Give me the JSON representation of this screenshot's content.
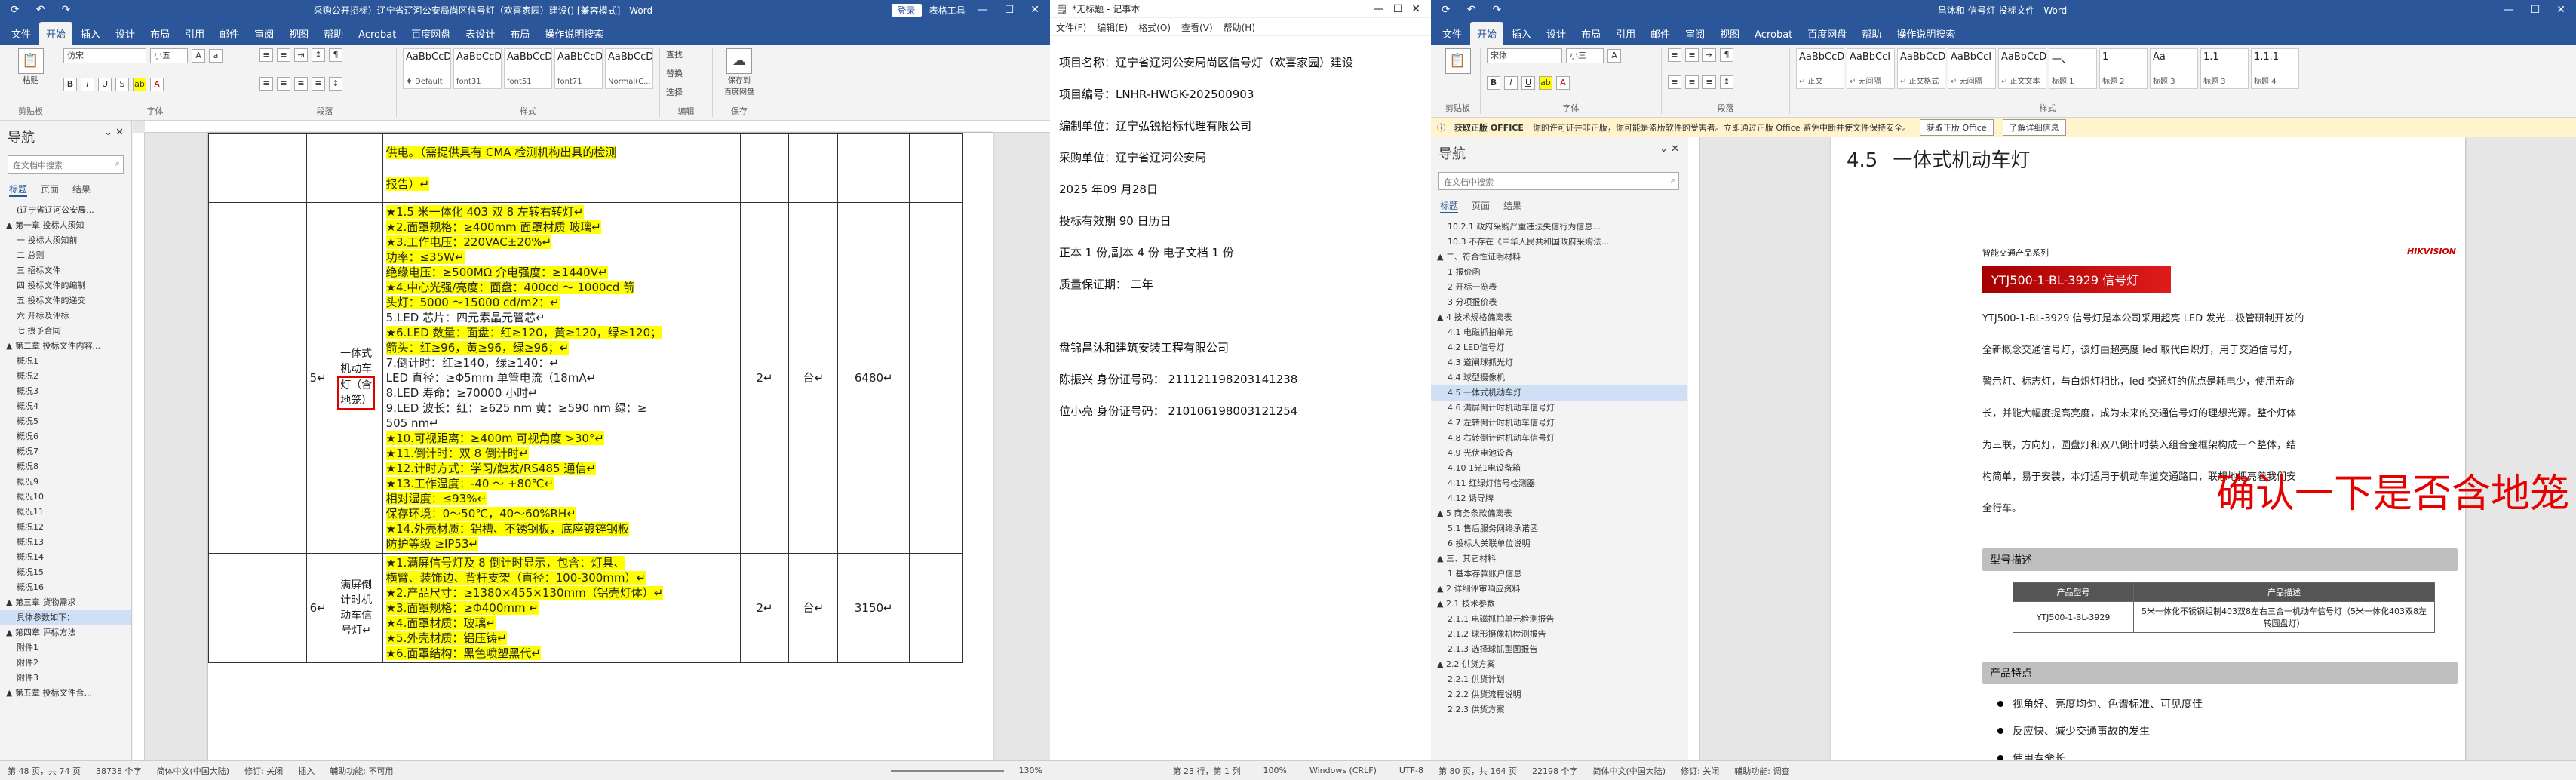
{
  "w1": {
    "title": "采购公开招标）辽宁省辽河公安局尚区信号灯（欢喜家园）建设() [兼容模式] - Word",
    "title_sign": "登录",
    "title_tool": "表格工具",
    "menu": [
      "文件",
      "开始",
      "插入",
      "设计",
      "布局",
      "引用",
      "邮件",
      "审阅",
      "视图",
      "帮助",
      "Acrobat",
      "百度网盘",
      "表设计",
      "布局"
    ],
    "menu_tell": "操作说明搜索",
    "ribbon": {
      "paste": "粘贴",
      "font_name": "仿宋",
      "font_size": "小五",
      "groups": [
        "剪贴板",
        "字体",
        "段落",
        "样式",
        "编辑",
        "保存",
        "加载项"
      ],
      "styles": [
        {
          "prev": "AaBbCcDd",
          "nm": "♦ Default"
        },
        {
          "prev": "AaBbCcDd",
          "nm": "font31"
        },
        {
          "prev": "AaBbCcDd",
          "nm": "font51"
        },
        {
          "prev": "AaBbCcDd",
          "nm": "font71"
        },
        {
          "prev": "AaBbCcDc",
          "nm": "Normal(C..."
        }
      ],
      "edit": [
        "查找",
        "替换",
        "选择"
      ],
      "save": "保存到\n百度网盘"
    },
    "nav": {
      "title": "导航",
      "search": "在文档中搜索",
      "tabs": [
        "标题",
        "页面",
        "结果"
      ],
      "items": [
        "(辽宁省辽河公安局...",
        "▲ 第一章 投标人须知",
        "一 投标人须知前",
        "二 总则",
        "三 招标文件",
        "四 投标文件的编制",
        "五 投标文件的递交",
        "六 开标及评标",
        "七 授予合同",
        "▲ 第二章 投标文件内容...",
        "概况1",
        "概况2",
        "概况3",
        "概况4",
        "概况5",
        "概况6",
        "概况7",
        "概况8",
        "概况9",
        "概况10",
        "概况11",
        "概况12",
        "概况13",
        "概况14",
        "概况15",
        "概况16",
        "▲ 第三章 货物需求",
        "具体参数如下：",
        "▲ 第四章 评标方法",
        "附件1",
        "附件2",
        "附件3",
        "▲ 第五章 投标文件合..."
      ],
      "selected_index": 27
    },
    "table": {
      "row_top": {
        "spec_lines": [
          "供电。（需提供具有 CMA 检测机构出具的检测",
          "报告）↵"
        ]
      },
      "row5": {
        "no": "5↵",
        "name_lines": [
          "一体式",
          "机动车",
          "灯（含",
          "地笼）"
        ],
        "spec_lines": [
          "★1.5 米一体化 403 双 8 左转右转灯↵",
          "★2.面罩规格：≥400mm 面罩材质 玻璃↵",
          "★3.工作电压：220VAC±20%↵",
          "功率：≤35W↵",
          "绝缘电压：≥500MΩ  介电强度：≥1440V↵",
          "★4.中心光强/亮度：面盘：400cd ～ 1000cd  箭",
          "头灯：5000 ～15000 cd/m2：↵",
          "5.LED 芯片：四元素晶元管芯↵",
          "★6.LED 数量：面盘：红≥120，黄≥120，绿≥120；",
          "箭头：红≥96，黄≥96，绿≥96；↵",
          "7.倒计时：红≥140，绿≥140：↵",
          "LED 直径：≥Φ5mm 单管电流（18mA↵",
          "8.LED 寿命：≥70000 小时↵",
          "9.LED 波长：红：≥625 nm 黄：≥590 nm 绿：≥",
          "505 nm↵",
          "★10.可视距离：≥400m 可视角度 >30°↵",
          "★11.倒计时：双 8 倒计时↵",
          "★12.计时方式：学习/触发/RS485 通信↵",
          "★13.工作温度：-40 ～ +80℃↵",
          "相对湿度：≤93%↵",
          "保存环境：0～50℃，40～60%RH↵",
          "★14.外壳材质：铝槽、不锈钢板，底座镀锌钢板",
          "防护等级 ≥IP53↵"
        ],
        "qty": "2↵",
        "unit": "台↵",
        "price": "6480↵"
      },
      "row6": {
        "no": "6↵",
        "name_lines": [
          "满屏倒",
          "计时机",
          "动车信",
          "号灯↵"
        ],
        "spec_lines": [
          "★1.满屏信号灯及 8 倒计时显示，包含：灯具、",
          "横臂、装饰边、背杆支架（直径：100-300mm）↵",
          "★2.产品尺寸：≥1380×455×130mm（铝壳灯体）↵",
          "★3.面罩规格：≥Φ400mm ↵",
          "★4.面罩材质：玻璃↵",
          "★5.外壳材质：铝压铸↵",
          "★6.面罩结构：黑色喷塑黑代↵"
        ],
        "qty": "2↵",
        "unit": "台↵",
        "price": "3150↵"
      }
    },
    "status": [
      "第 48 页，共 74 页",
      "38738 个字",
      "简体中文(中国大陆)",
      "修订: 关闭",
      "插入",
      "辅助功能: 不可用"
    ],
    "zoom": "130%"
  },
  "w2": {
    "title": "*无标题 - 记事本",
    "menu": [
      "文件(F)",
      "编辑(E)",
      "格式(O)",
      "查看(V)",
      "帮助(H)"
    ],
    "lines": [
      "项目名称：辽宁省辽河公安局尚区信号灯（欢喜家园）建设",
      "项目编号：LNHR-HWGK-202500903",
      "编制单位：辽宁弘锐招标代理有限公司",
      "采购单位：辽宁省辽河公安局",
      "2025 年09 月28日",
      "投标有效期 90 日历日",
      "正本 1 份,副本 4 份  电子文档  1 份",
      "质量保证期：   二年",
      "",
      "盘锦昌沐和建筑安装工程有限公司",
      "陈振兴   身份证号码：   211121198203141238",
      "位小亮   身份证号码：   210106198003121254"
    ],
    "status": [
      "第 23 行，第 1 列",
      "100%",
      "Windows (CRLF)",
      "UTF-8"
    ]
  },
  "w3": {
    "title": "昌沐和-信号灯-投标文件 - Word",
    "menu": [
      "文件",
      "开始",
      "插入",
      "设计",
      "布局",
      "引用",
      "邮件",
      "审阅",
      "视图",
      "Acrobat",
      "百度网盘",
      "帮助",
      "操作说明搜索"
    ],
    "ribbon": {
      "font_name": "宋体",
      "font_size": "小三",
      "groups": [
        "剪贴板",
        "字体",
        "段落",
        "样式"
      ],
      "styles": [
        {
          "prev": "AaBbCcDc",
          "nm": "↵ 正文"
        },
        {
          "prev": "AaBbCcI",
          "nm": "↵ 无间隔"
        },
        {
          "prev": "AaBbCcDc",
          "nm": "↵ 正文格式"
        },
        {
          "prev": "AaBbCcI",
          "nm": "↵ 无间隔"
        },
        {
          "prev": "AaBbCcDc",
          "nm": "↵ 正文文本"
        },
        {
          "prev": "一、",
          "nm": "标题 1"
        },
        {
          "prev": "1",
          "nm": "标题 2"
        },
        {
          "prev": "Aa",
          "nm": "标题 3"
        },
        {
          "prev": "1.1",
          "nm": "标题 3"
        },
        {
          "prev": "1.1.1",
          "nm": "标题 4"
        }
      ]
    },
    "infobar": {
      "label": "获取正版 OFFICE",
      "text": "你的许可证并非正版，你可能是盗版软件的受害者。立即通过正版 Office 避免中断并使文件保持安全。",
      "btn1": "获取正版 Office",
      "btn2": "了解详细信息"
    },
    "nav": {
      "title": "导航",
      "search": "在文档中搜索",
      "tabs": [
        "标题",
        "页面",
        "结果"
      ],
      "items": [
        "10.2.1 政府采购严重违法失信行为信息...",
        "10.3 不存在《中华人民共和国政府采购法...",
        "▲ 二、符合性证明材料",
        "1 报价函",
        "2 开标一览表",
        "3 分项报价表",
        "▲ 4 技术规格偏离表",
        "4.1 电磁抓拍单元",
        "4.2 LED信号灯",
        "4.3 道闸球抓光灯",
        "4.4 球型摄像机",
        "4.5 一体式机动车灯",
        "4.6 满屏倒计时机动车信号灯",
        "4.7 左转倒计时机动车信号灯",
        "4.8 右转倒计时机动车信号灯",
        "4.9 光伏电池设备",
        "4.10 1光1电设备箱",
        "4.11 红绿灯信号检测器",
        "4.12 诱导牌",
        "▲ 5 商务条款偏离表",
        "5.1 售后服务网络承诺函",
        "6 投标人关联单位说明",
        "▲ 三、其它材料",
        "1 基本存款账户信息",
        "▲ 2 详细评审响应资料",
        "▲ 2.1 技术参数",
        "2.1.1 电磁抓拍单元检测报告",
        "2.1.2 球形摄像机检测报告",
        "2.1.3 选择球抓型图报告",
        "▲ 2.2 供货方案",
        "2.2.1 供货计划",
        "2.2.2 供货流程说明",
        "2.2.3 供货方案"
      ],
      "selected_index": 11
    },
    "doc": {
      "heading_num": "4.5",
      "heading_text": "一体式机动车灯",
      "series": "智能交通产品系列",
      "brand": "HIKVISION",
      "model_bar": "YTJ500-1-BL-3929 信号灯",
      "paragraph_lines": [
        "YTJ500-1-BL-3929 信号灯是本公司采用超亮 LED 发光二极管研制开发的",
        "全新概念交通信号灯，该灯由超亮度 led 取代白炽灯，用于交通信号灯，",
        "警示灯、标志灯，与白炽灯相比，led 交通灯的优点是耗电少，使用寿命",
        "长，并能大幅度提高亮度，成为未来的交通信号灯的理想光源。整个灯体",
        "为三联，方向灯，圆盘灯和双八倒计时装入组合金框架构成一个整体，结",
        "构简单，易于安装，本灯适用于机动车道交通路口，联想地把亮着我们安",
        "全行车。"
      ],
      "type_head": "型号描述",
      "table_head": [
        "产品型号",
        "产品描述"
      ],
      "table_row": [
        "YTJ500-1-BL-3929",
        "5米一体化不锈钢组制403双8左右三合一机动车信号灯（5米一体化403双8左转圆盘灯）"
      ],
      "feature_head": "产品特点",
      "features": [
        "视角好、亮度均匀、色谱标准、可见度佳",
        "反应快、减少交通事故的发生",
        "使用寿命长"
      ]
    },
    "overlay": "确认一下是否含地笼",
    "status": [
      "第 80 页，共 164 页",
      "22198 个字",
      "简体中文(中国大陆)",
      "修订: 关闭",
      "辅助功能: 调查"
    ]
  }
}
